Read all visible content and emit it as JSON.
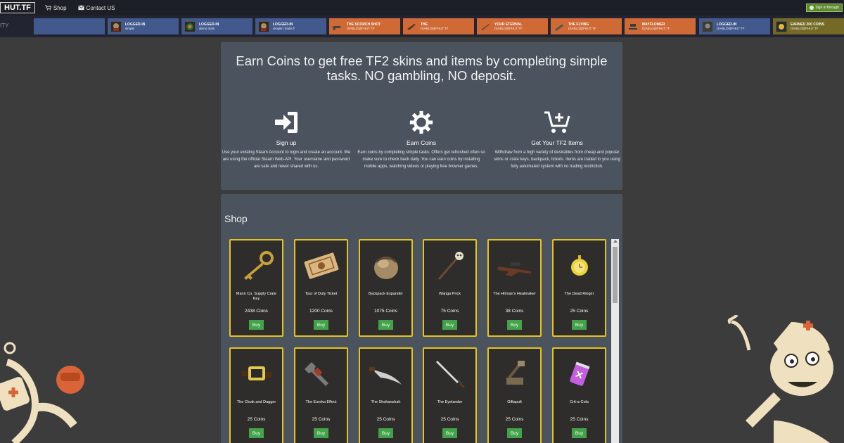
{
  "nav": {
    "logo": "HUT.TF",
    "links": [
      {
        "label": "Shop",
        "icon": "cart-icon"
      },
      {
        "label": "Contact US",
        "icon": "envelope-icon"
      }
    ],
    "steam_login": "Sign in through"
  },
  "ticker": {
    "label": "ITY",
    "items": [
      {
        "line1": "",
        "line2": "",
        "color": "blue"
      },
      {
        "line1": "LOGGED-IN",
        "line2": "simple",
        "color": "blue"
      },
      {
        "line1": "LOGGED-IN",
        "line2": "demo trials",
        "color": "blue"
      },
      {
        "line1": "LOGGED-IN",
        "line2": "simple | trade.tf",
        "color": "blue"
      },
      {
        "line1": "THE SCORCH SHOT",
        "line2": "DIABLO@FHUT.TF",
        "color": "orange"
      },
      {
        "line1": "THE",
        "line2": "DIABLO@FHUT.TF",
        "color": "orange"
      },
      {
        "line1": "YOUR ETERNAL",
        "line2": "DIABLO@FHUT.TF",
        "color": "orange"
      },
      {
        "line1": "THE FLYING",
        "line2": "DIABLO@FHUT.TF",
        "color": "orange"
      },
      {
        "line1": "MAYFLOWER",
        "line2": "DIABLO@FHUT.TF",
        "color": "orange"
      },
      {
        "line1": "LOGGED-IN",
        "line2": "DIABLO@FHUT.TF",
        "color": "blue"
      },
      {
        "line1": "EARNED 200 COINS",
        "line2": "DIABLO@FHUT.TF",
        "color": "olive"
      }
    ]
  },
  "hero": {
    "title": "Earn Coins to get free TF2 skins and items by completing simple tasks. NO gambling, NO deposit.",
    "features": [
      {
        "icon": "sign-in-icon",
        "title": "Sign up",
        "text": "Use your existing Steam Account to login and create an account. We are using the official Steam Web-API. Your username and password are safe and never shared with us."
      },
      {
        "icon": "gear-icon",
        "title": "Earn Coins",
        "text": "Earn coins by completing simple tasks. Offers get refreshed often so make sure to check back daily. You can earn coins by installing mobile apps, watching videos or playing free browser games."
      },
      {
        "icon": "cart-plus-icon",
        "title": "Get Your TF2 Items",
        "text": "Withdraw from a high variety of desirables from cheap and popular skins or crate keys, backpack, tickets. Items are traded to you using fully automated system with no trading restriction."
      }
    ]
  },
  "shop": {
    "title": "Shop",
    "buy_label": "Buy",
    "items": [
      {
        "name": "Mann Co. Supply Crate Key",
        "price": "2438 Coins",
        "icon": "key-icon"
      },
      {
        "name": "Tour of Duty Ticket",
        "price": "1200 Coins",
        "icon": "ticket-icon"
      },
      {
        "name": "Backpack Expander",
        "price": "1075 Coins",
        "icon": "backpack-icon"
      },
      {
        "name": "Wanga Prick",
        "price": "75 Coins",
        "icon": "voodoo-pin-icon"
      },
      {
        "name": "The Hitman's Heatmaker",
        "price": "38 Coins",
        "icon": "sniper-rifle-icon"
      },
      {
        "name": "The Dead Ringer",
        "price": "25 Coins",
        "icon": "pocket-watch-icon"
      },
      {
        "name": "The Cloak and Dagger",
        "price": "25 Coins",
        "icon": "cloak-watch-icon"
      },
      {
        "name": "The Eureka Effect",
        "price": "25 Coins",
        "icon": "wrench-icon"
      },
      {
        "name": "The Shahanshah",
        "price": "25 Coins",
        "icon": "scimitar-icon"
      },
      {
        "name": "The Eyelander",
        "price": "25 Coins",
        "icon": "sword-icon"
      },
      {
        "name": "Giftapult",
        "price": "25 Coins",
        "icon": "catapult-icon"
      },
      {
        "name": "Crit-a-Cola",
        "price": "25 Coins",
        "icon": "soda-can-icon"
      }
    ]
  },
  "colors": {
    "background": "#3c3c3c",
    "panel": "#4b535f",
    "card_border": "#e6c324",
    "buy_button": "#44a24a",
    "ticker_blue": "#41598c",
    "ticker_orange": "#cf6a37"
  }
}
